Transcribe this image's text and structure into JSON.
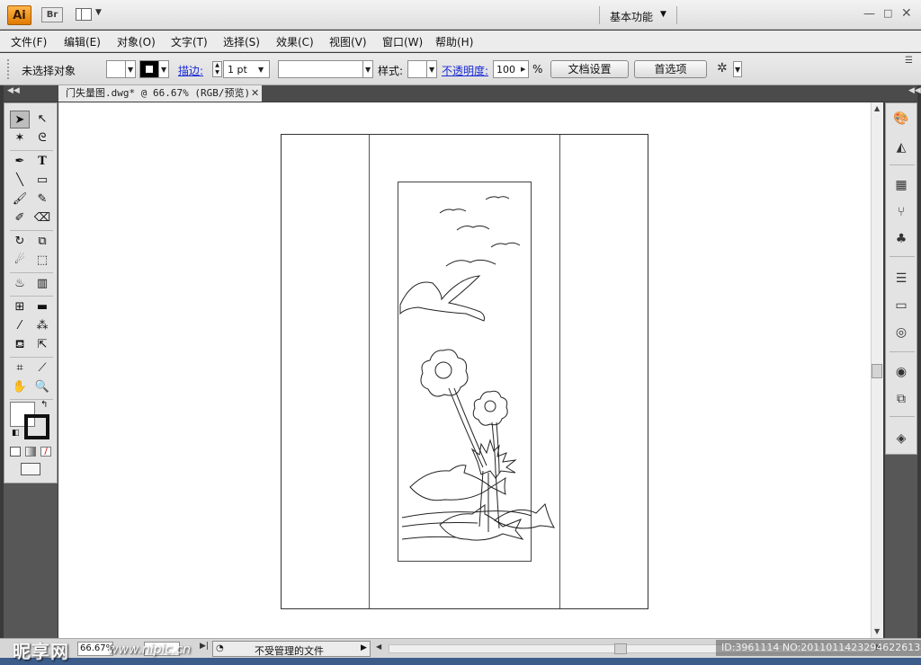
{
  "titlebar": {
    "app_logo": "Ai",
    "bridge_label": "Br",
    "workspace": "基本功能",
    "min": "—",
    "max": "□",
    "close": "✕"
  },
  "menu": {
    "items": [
      "文件(F)",
      "编辑(E)",
      "对象(O)",
      "文字(T)",
      "选择(S)",
      "效果(C)",
      "视图(V)",
      "窗口(W)",
      "帮助(H)"
    ]
  },
  "control": {
    "selection_status": "未选择对象",
    "stroke_label": "描边:",
    "stroke_weight": "1 pt",
    "style_label": "样式:",
    "opacity_label": "不透明度:",
    "opacity_value": "100",
    "opacity_unit": "%",
    "doc_setup_label": "文档设置",
    "preferences_label": "首选项"
  },
  "document": {
    "tab_title": "门失量图.dwg* @ 66.67% (RGB/预览)",
    "tab_close": "✕"
  },
  "statusbar": {
    "zoom": "66.67%",
    "status_text": "不受管理的文件"
  },
  "watermark": {
    "logo": "昵享网",
    "url": "www.nipic.cn",
    "id_text": "ID:3961114 NO:20110114232946226134"
  },
  "colors": {
    "accent": "#f08c00",
    "link": "#1a2bd8",
    "panel_dark": "#575757"
  },
  "icons": {
    "tools": [
      "selection-tool-icon",
      "direct-selection-tool-icon",
      "magic-wand-tool-icon",
      "lasso-tool-icon",
      "pen-tool-icon",
      "type-tool-icon",
      "line-tool-icon",
      "rectangle-tool-icon",
      "paintbrush-tool-icon",
      "pencil-tool-icon",
      "blob-brush-tool-icon",
      "eraser-tool-icon",
      "rotate-tool-icon",
      "scale-tool-icon",
      "warp-tool-icon",
      "free-transform-tool-icon",
      "symbol-sprayer-tool-icon",
      "graph-tool-icon",
      "mesh-tool-icon",
      "gradient-tool-icon",
      "eyedropper-tool-icon",
      "blend-tool-icon",
      "live-paint-bucket-tool-icon",
      "live-paint-selection-tool-icon",
      "artboard-tool-icon",
      "slice-tool-icon",
      "hand-tool-icon",
      "zoom-tool-icon"
    ],
    "panels": [
      "color-panel-icon",
      "color-guide-panel-icon",
      "swatches-panel-icon",
      "brushes-panel-icon",
      "symbols-panel-icon",
      "stroke-panel-icon",
      "gradient-panel-icon",
      "transparency-panel-icon",
      "appearance-panel-icon",
      "graphic-styles-panel-icon",
      "layers-panel-icon"
    ]
  }
}
